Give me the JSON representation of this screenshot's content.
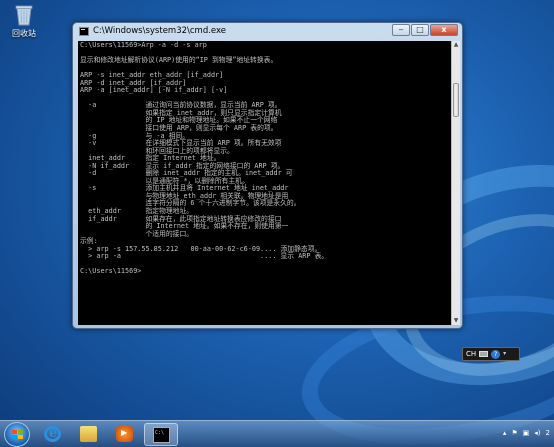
{
  "desktop": {
    "recycle_bin_label": "回收站"
  },
  "window": {
    "title": "C:\\Windows\\system32\\cmd.exe",
    "minimize_label": "‒",
    "maximize_label": "□",
    "close_label": "x"
  },
  "console": {
    "lines": [
      "C:\\Users\\11569>Arp -a -d -s arp",
      "",
      "显示和修改地址解析协议(ARP)使用的“IP 到物理”地址转换表。",
      "",
      "ARP -s inet_addr eth_addr [if_addr]",
      "ARP -d inet_addr [if_addr]",
      "ARP -a [inet_addr] [-N if_addr] [-v]",
      "",
      "  -a            通过询问当前协议数据，显示当前 ARP 项。",
      "                如果指定 inet_addr，则只显示指定计算机",
      "                的 IP 地址和物理地址。如果不止一个网络",
      "                接口使用 ARP，则显示每个 ARP 表的项。",
      "  -g            与 -a 相同。",
      "  -v            在详细模式下显示当前 ARP 项。所有无效项",
      "                和环回接口上的项都将显示。",
      "  inet_addr     指定 Internet 地址。",
      "  -N if_addr    显示 if_addr 指定的网络接口的 ARP 项。",
      "  -d            删除 inet_addr 指定的主机。inet_addr 可",
      "                以是通配符 *，以删除所有主机。",
      "  -s            添加主机并且将 Internet 地址 inet_addr",
      "                与物理地址 eth_addr 相关联。物理地址是用",
      "                连字符分隔的 6 个十六进制字节。该项是永久的。",
      "  eth_addr      指定物理地址。",
      "  if_addr       如果存在，此项指定地址转换表应修改的接口",
      "                的 Internet 地址。如果不存在，则使用第一",
      "                个适用的接口。",
      "示例:",
      "  > arp -s 157.55.85.212   00-aa-00-62-c6-09.... 添加静态项。",
      "  > arp -a                                  .... 显示 ARP 表。",
      "",
      "C:\\Users\\11569>",
      "",
      "",
      "",
      ""
    ]
  },
  "language_bar": {
    "lang": "CH"
  },
  "taskbar": {
    "clock_hint": "2"
  }
}
